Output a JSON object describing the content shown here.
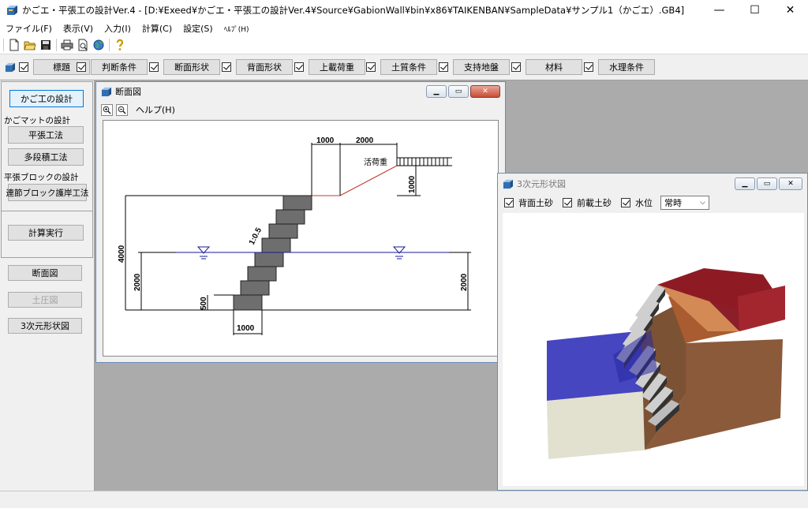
{
  "window": {
    "title": "かごエ・平張工の設計Ver.4 - [D:¥Exeed¥かごエ・平張工の設計Ver.4¥Source¥GabionWall¥bin¥x86¥TAIKENBAN¥SampleData¥サンプル1（かごエ）.GB4]",
    "minimize": "—",
    "maximize": "☐",
    "close": "✕"
  },
  "menu": [
    {
      "label": "ファイル(F)"
    },
    {
      "label": "表示(V)"
    },
    {
      "label": "入力(I)"
    },
    {
      "label": "計算(C)"
    },
    {
      "label": "設定(S)"
    },
    {
      "label": "ﾍﾙﾌﾟ(H)"
    }
  ],
  "toolbar_icons": [
    "new-file-icon",
    "open-folder-icon",
    "save-icon",
    "print-icon",
    "print-preview-icon",
    "globe-icon",
    "help-icon"
  ],
  "steps": [
    {
      "label": "標題",
      "checked": true
    },
    {
      "label": "判断条件",
      "checked": true
    },
    {
      "label": "断面形状",
      "checked": true
    },
    {
      "label": "背面形状",
      "checked": true
    },
    {
      "label": "上載荷重",
      "checked": true
    },
    {
      "label": "土質条件",
      "checked": true
    },
    {
      "label": "支持地盤",
      "checked": true
    },
    {
      "label": "材料",
      "checked": true
    },
    {
      "label": "水理条件",
      "checked": true
    }
  ],
  "left_panel": {
    "design_gabion": "かご工の設計",
    "mat_section": "かごマットの設計",
    "flat_method": "平張工法",
    "multi_stage_method": "多段積工法",
    "block_section": "平張ブロックの設計",
    "block_revetment": "連節ブロック護岸工法",
    "run_calc": "計算実行",
    "section_view": "断面図",
    "earth_pressure_view": "土圧図",
    "view_3d": "3次元形状図"
  },
  "section_window": {
    "title": "断面図",
    "help": "ヘルプ(H)",
    "dims": {
      "top_left": "1000",
      "top_right": "2000",
      "surcharge_height": "1000",
      "total_height": "4000",
      "left_water": "2000",
      "right_water": "2000",
      "base_height": "500",
      "base_width": "1000",
      "slope": "1:0.5"
    },
    "load_label": "活荷重"
  },
  "view3d_window": {
    "title": "3次元形状図",
    "chk_backfill": "背面土砂",
    "chk_front": "前載土砂",
    "chk_water": "水位",
    "mode": "常時"
  }
}
